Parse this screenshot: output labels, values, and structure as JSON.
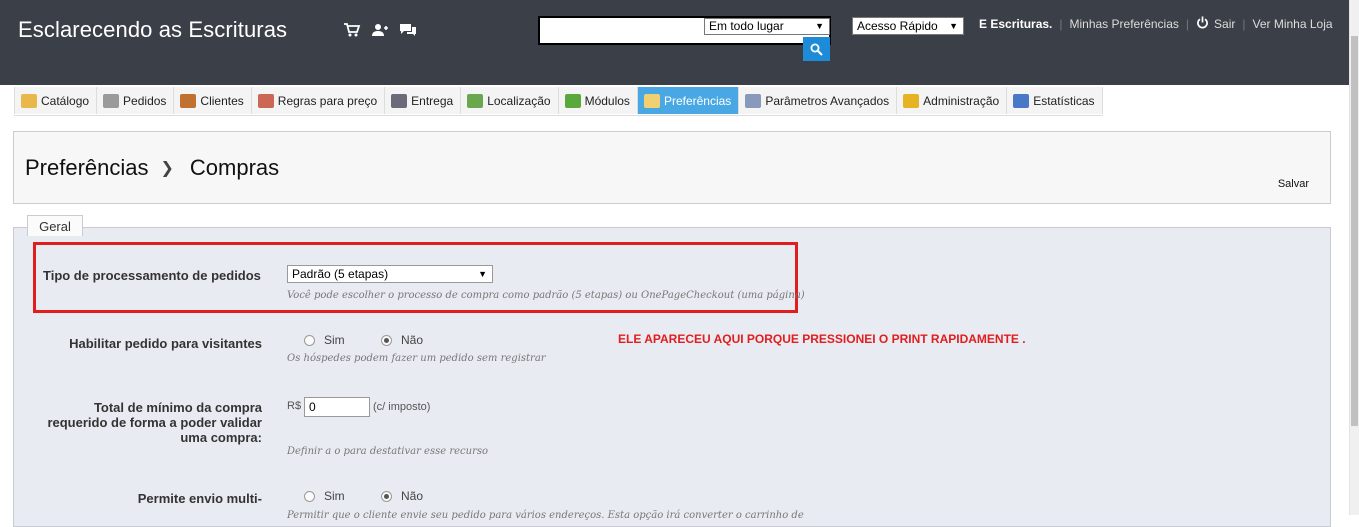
{
  "header": {
    "brand": "Esclarecendo as Escrituras",
    "icons": [
      "cart-icon",
      "users-icon",
      "chat-icon"
    ],
    "search": {
      "value": "",
      "scope": "Em todo lugar"
    },
    "quick_access": "Acesso Rápido",
    "links": {
      "user": "E Escrituras.",
      "preferences": "Minhas Preferências",
      "logout": "Sair",
      "store": "Ver Minha Loja"
    }
  },
  "nav": {
    "tabs": [
      {
        "label": "Catálogo",
        "icon": "folder-icon",
        "color": "#e8b84a"
      },
      {
        "label": "Pedidos",
        "icon": "cart-icon",
        "color": "#9a9a9a"
      },
      {
        "label": "Clientes",
        "icon": "person-icon",
        "color": "#c0702f"
      },
      {
        "label": "Regras para preço",
        "icon": "price-rules-icon",
        "color": "#cc6655"
      },
      {
        "label": "Entrega",
        "icon": "truck-icon",
        "color": "#6a6a7a"
      },
      {
        "label": "Localização",
        "icon": "globe-icon",
        "color": "#6aa84f"
      },
      {
        "label": "Módulos",
        "icon": "puzzle-icon",
        "color": "#5aa83c"
      },
      {
        "label": "Preferências",
        "icon": "preferences-icon",
        "color": "#f0d070",
        "active": true
      },
      {
        "label": "Parâmetros Avançados",
        "icon": "wrench-icon",
        "color": "#8899bb"
      },
      {
        "label": "Administração",
        "icon": "key-icon",
        "color": "#e6b422"
      },
      {
        "label": "Estatísticas",
        "icon": "bar-chart-icon",
        "color": "#4a78c8"
      }
    ]
  },
  "breadcrumb": {
    "parent": "Preferências",
    "current": "Compras"
  },
  "toolbar": {
    "save_label": "Salvar"
  },
  "form": {
    "legend": "Geral",
    "order_process": {
      "label": "Tipo de processamento de pedidos",
      "value": "Padrão (5 etapas)",
      "help": "Você pode escolher o processo de compra como padrão (5 etapas) ou OnePageCheckout (uma página)"
    },
    "guest_checkout": {
      "label": "Habilitar pedido para visitantes",
      "yes": "Sim",
      "no": "Não",
      "selected": "no",
      "help": "Os hóspedes podem fazer um pedido sem registrar"
    },
    "annotation": "ELE APARECEU AQUI PORQUE PRESSIONEI O PRINT RAPIDAMENTE .",
    "min_purchase": {
      "label_lines": [
        "Total de mínimo da compra",
        "requerido de forma a poder validar",
        "uma compra:"
      ],
      "currency": "R$",
      "value": "0",
      "suffix": "(c/ imposto)",
      "help": "Definir a o para destativar esse recurso"
    },
    "multi_shipping": {
      "label": "Permite envio multi-",
      "yes": "Sim",
      "no": "Não",
      "selected": "no",
      "help": "Permitir que o cliente envie seu pedido para vários endereços. Esta opção irá converter o carrinho de"
    }
  }
}
